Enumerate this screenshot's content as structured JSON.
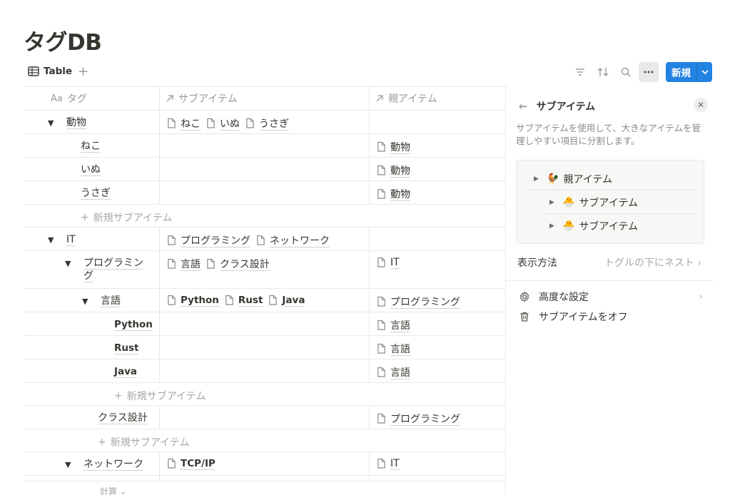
{
  "page": {
    "title": "タグDB"
  },
  "viewbar": {
    "tab_label": "Table",
    "add": "+",
    "new_button": "新規"
  },
  "table": {
    "headers": {
      "name_prefix": "Aa",
      "name": "タグ",
      "sub": "サブアイテム",
      "parent": "親アイテム"
    },
    "add_sub_label": "新規サブアイテム",
    "calc_label": "計算",
    "rows": [
      {
        "name": "動物",
        "toggle": "▼",
        "sub": [
          "ねこ",
          "いぬ",
          "うさぎ"
        ],
        "parent": ""
      },
      {
        "name": "ねこ",
        "sub": [],
        "parent": "動物"
      },
      {
        "name": "いぬ",
        "sub": [],
        "parent": "動物"
      },
      {
        "name": "うさぎ",
        "sub": [],
        "parent": "動物"
      },
      {
        "name": "IT",
        "toggle": "▼",
        "sub": [
          "プログラミング",
          "ネットワーク"
        ],
        "parent": ""
      },
      {
        "name_line1": "プログラミン",
        "name_line2": "グ",
        "toggle": "▼",
        "sub": [
          "言語",
          "クラス設計"
        ],
        "parent": "IT"
      },
      {
        "name": "言語",
        "toggle": "▼",
        "sub": [
          "Python",
          "Rust",
          "Java"
        ],
        "parent": "プログラミング"
      },
      {
        "name": "Python",
        "sub": [],
        "parent": "言語"
      },
      {
        "name": "Rust",
        "sub": [],
        "parent": "言語"
      },
      {
        "name": "Java",
        "sub": [],
        "parent": "言語"
      },
      {
        "name": "クラス設計",
        "sub": [],
        "parent": "プログラミング"
      },
      {
        "name": "ネットワーク",
        "toggle": "▼",
        "sub": [
          "TCP/IP"
        ],
        "parent": "IT"
      }
    ]
  },
  "panel": {
    "title": "サブアイテム",
    "close": "✕",
    "description": "サブアイテムを使用して、大きなアイテムを管理しやすい項目に分割します。",
    "preview": {
      "parent": "親アイテム",
      "child1": "サブアイテム",
      "child2": "サブアイテム"
    },
    "display_label": "表示方法",
    "display_value": "トグルの下にネスト",
    "advanced": "高度な設定",
    "turn_off": "サブアイテムをオフ"
  },
  "colors": {
    "accent": "#2383e2",
    "text": "#37352f",
    "muted": "#9b9a97",
    "border": "#e9e9e7"
  }
}
